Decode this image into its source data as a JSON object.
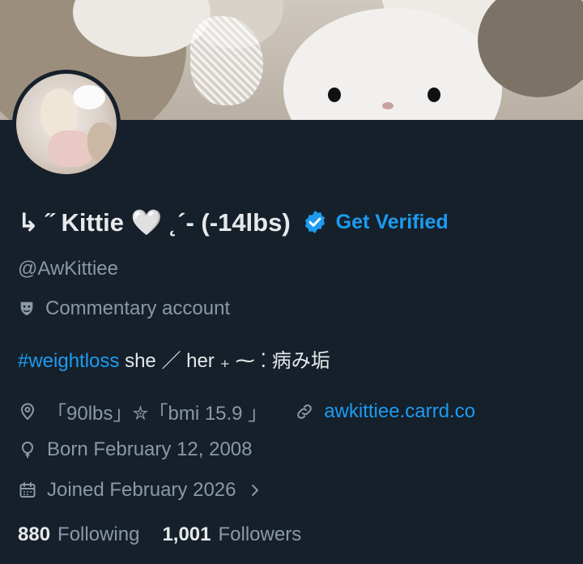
{
  "profile": {
    "display_name": "↳ ˝  Kittie 🤍 ˛´- (-14lbs)",
    "get_verified_label": "Get Verified",
    "handle": "@AwKittiee",
    "account_label": "Commentary account",
    "bio_hashtag": "#weightloss",
    "bio_text": " she ／ her ₊ ⁓ ⁚ 病み垢",
    "location": "「90lbs」✮「bmi 15.9 」",
    "website": "awkittiee.carrd.co",
    "birthday": "Born February 12, 2008",
    "joined": "Joined February 2026",
    "following_count": "880",
    "following_label": "Following",
    "followers_count": "1,001",
    "followers_label": "Followers"
  },
  "colors": {
    "background": "#15202b",
    "accent": "#1d9bf0",
    "secondary_text": "#8b98a5",
    "primary_text": "#e7e9ea"
  },
  "icons": {
    "verified": "verified-badge-icon",
    "account_label": "theater-mask-icon",
    "location": "location-pin-icon",
    "website": "link-icon",
    "birthday": "balloon-icon",
    "joined": "calendar-icon",
    "joined_chevron": "chevron-right-icon"
  }
}
